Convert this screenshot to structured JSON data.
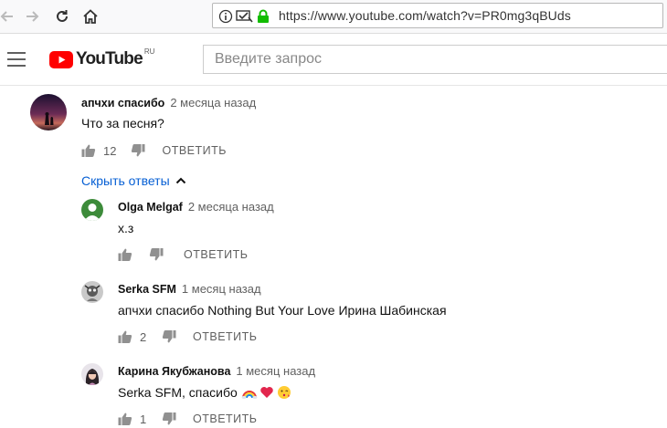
{
  "browser": {
    "url": "https://www.youtube.com/watch?v=PR0mg3qBUds"
  },
  "header": {
    "logo_text": "YouTube",
    "logo_region": "RU",
    "search_placeholder": "Введите запрос"
  },
  "comments": [
    {
      "author": "апчхи спасибо",
      "time": "2 месяца назад",
      "text": "Что за песня?",
      "likes": "12",
      "reply_label": "ОТВЕТИТЬ"
    }
  ],
  "hide_replies_label": "Скрыть ответы",
  "replies": [
    {
      "author": "Olga Melgaf",
      "time": "2 месяца назад",
      "text": "х.з",
      "likes": "",
      "reply_label": "ОТВЕТИТЬ"
    },
    {
      "author": "Serka SFM",
      "time": "1 месяц назад",
      "text": "апчхи спасибо Nothing But Your Love Ирина Шабинская",
      "likes": "2",
      "reply_label": "ОТВЕТИТЬ"
    },
    {
      "author": "Карина Якубжанова",
      "time": "1 месяц назад",
      "text": "Serka SFM, спасибо",
      "likes": "1",
      "reply_label": "ОТВЕТИТЬ"
    }
  ],
  "colors": {
    "youtube_red": "#ff0000",
    "link_blue": "#065fd4",
    "secondary_text": "#606060",
    "lock_green": "#12bc00"
  }
}
